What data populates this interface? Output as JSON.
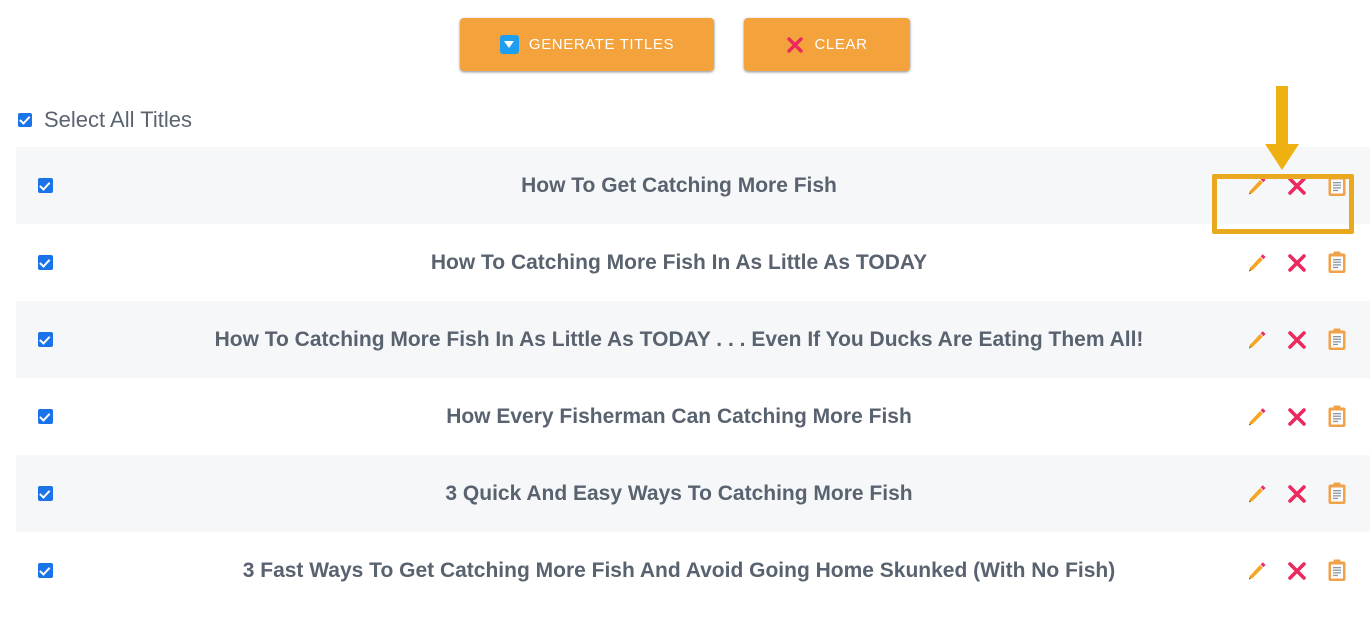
{
  "toolbar": {
    "generate_label": "GENERATE TITLES",
    "generate_icon": "download-triangle-icon",
    "clear_label": "CLEAR",
    "clear_icon": "x-mark-icon",
    "button_color": "#f4a23c",
    "generate_icon_color": "#1e9ef0",
    "clear_icon_color": "#ea2a5f"
  },
  "select_all": {
    "label": "Select All Titles",
    "checked": true,
    "checkbox_color": "#1a73e8"
  },
  "row_actions": {
    "edit_label": "edit",
    "delete_label": "delete",
    "copy_label": "copy",
    "edit_icon": "pencil-icon",
    "delete_icon": "x-mark-icon",
    "copy_icon": "clipboard-icon",
    "pencil_color": "#f5a623",
    "pencil_tip_color": "#ec2d6a",
    "x_color": "#ea2a5f",
    "clipboard_color": "#f0a24a"
  },
  "annotation": {
    "arrow_color": "#eeb111",
    "highlight_border_color": "#eaa81e",
    "arrow_icon": "down-arrow-annotation",
    "highlight_target": "row-actions-group"
  },
  "titles": [
    {
      "text": "How To Get Catching More Fish",
      "checked": true
    },
    {
      "text": "How To Catching More Fish In As Little As TODAY",
      "checked": true
    },
    {
      "text": "How To Catching More Fish In As Little As TODAY . . . Even If You Ducks Are Eating Them All!",
      "checked": true
    },
    {
      "text": "How Every Fisherman Can Catching More Fish",
      "checked": true
    },
    {
      "text": "3 Quick And Easy Ways To Catching More Fish",
      "checked": true
    },
    {
      "text": "3 Fast Ways To Get Catching More Fish And Avoid Going Home Skunked (With No Fish)",
      "checked": true
    }
  ]
}
